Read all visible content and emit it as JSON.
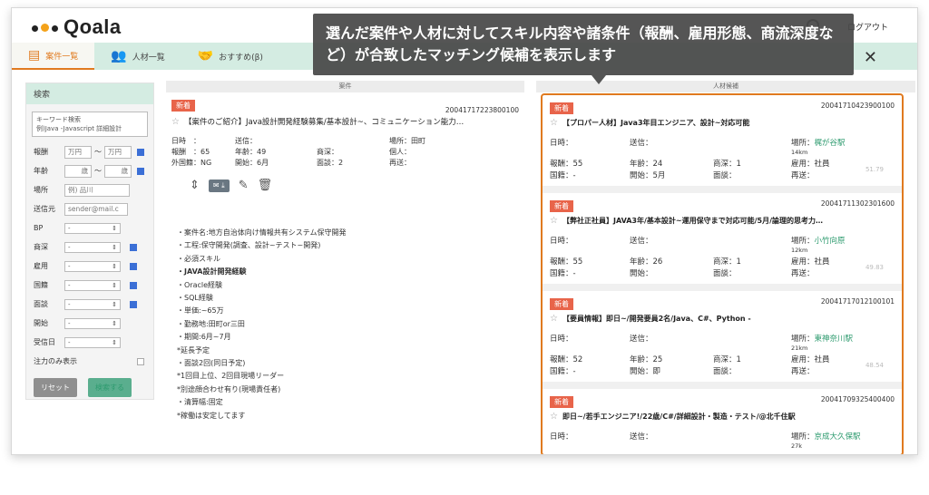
{
  "app": {
    "logo": "Qoala",
    "logout": "ログアウト"
  },
  "tabs": [
    {
      "label": "案件一覧",
      "icon": "list-icon"
    },
    {
      "label": "人材一覧",
      "icon": "people-icon"
    },
    {
      "label": "おすすめ(β)",
      "icon": "handshake-icon"
    }
  ],
  "callout": "選んだ案件や人材に対してスキル内容や諸条件（報酬、雇用形態、商流深度など）が合致したマッチング候補を表示します",
  "sidebar": {
    "title": "検索",
    "keyword_placeholder": "キーワード検索\n例)Java -Javascript 詳細設計",
    "reward_label": "報酬",
    "reward_from": "万円",
    "reward_sep": "〜",
    "reward_to": "万円",
    "age_label": "年齢",
    "age_from": "歳",
    "age_sep": "〜",
    "age_to": "歳",
    "place_label": "場所",
    "place_placeholder": "例) 品川",
    "sender_label": "送信元",
    "sender_placeholder": "sender@mail.c",
    "bp_label": "BP",
    "shoryu_label": "商深",
    "koyo_label": "雇用",
    "kokuseki_label": "国籍",
    "mensetsu_label": "面談",
    "kaishi_label": "開始",
    "jushin_label": "受信日",
    "select_value": "-",
    "focus_label": "注力のみ表示",
    "reset": "リセット",
    "search": "検索する"
  },
  "middle": {
    "header": "案件",
    "badge": "新着",
    "id": "20041717223800100",
    "title": "【案件のご紹介】Java設計開発経験募集/基本設計~、コミュニケーション能力…",
    "fields": [
      [
        "日時　：",
        "送信：",
        "",
        "場所：田町"
      ],
      [
        "報酬　：65",
        "年齢：49",
        "商深：",
        "個人："
      ],
      [
        "外国籍：NG",
        "開始：6月",
        "面談：2",
        "再送："
      ]
    ],
    "desc": [
      "・案件名:地方自治体向け情報共有システム保守開発",
      "・工程:保守開発(調査、設計~テスト~開発)",
      "・必須スキル",
      "・JAVA設計開発経験",
      "・Oracle経験",
      "・SQL経験",
      "・単価:~65万",
      "・勤務地:田町or三田",
      "・期間:6月~7月",
      "*延長予定",
      "・面談2回(同日予定)",
      "*1回目上位、2回目現場リーダー",
      "*別途顔合わせ有り(現場責任者)",
      "・清算幅:固定",
      "*稼働は安定してます"
    ]
  },
  "right": {
    "header": "人材候補",
    "cards": [
      {
        "badge": "新着",
        "id": "20041710423900100",
        "title": "【プロパー人材】Java3年目エンジニア、設計~対応可能",
        "c1": [
          "日時：",
          "報酬：55",
          "国籍：-"
        ],
        "c2": [
          "送信：",
          "年齢：24",
          "開始：5月"
        ],
        "c3": [
          "",
          "商深：1",
          "面談："
        ],
        "place": "場所：",
        "station": "梶が谷駅",
        "km": "14km",
        "koyo": "雇用：社員",
        "saiso": "再送：",
        "score": "51.79"
      },
      {
        "badge": "新着",
        "id": "20041711302301600",
        "title": "【弊社正社員】JAVA3年/基本設計~運用保守まで対応可能/5月/論理的思考力…",
        "c1": [
          "日時：",
          "報酬：55",
          "国籍：-"
        ],
        "c2": [
          "送信：",
          "年齢：26",
          "開始："
        ],
        "c3": [
          "",
          "商深：1",
          "面談："
        ],
        "place": "場所：",
        "station": "小竹向原",
        "km": "12km",
        "koyo": "雇用：社員",
        "saiso": "再送：",
        "score": "49.83"
      },
      {
        "badge": "新着",
        "id": "20041717012100101",
        "title": "【要員情報】即日~/開発要員2名/Java、C#、Python -",
        "c1": [
          "日時：",
          "報酬：52",
          "国籍：-"
        ],
        "c2": [
          "送信：",
          "年齢：25",
          "開始：即"
        ],
        "c3": [
          "",
          "商深：1",
          "面談："
        ],
        "place": "場所：",
        "station": "東神奈川駅",
        "km": "21km",
        "koyo": "雇用：社員",
        "saiso": "再送：",
        "score": "48.54"
      },
      {
        "badge": "新着",
        "id": "20041709325400400",
        "title": "即日~/若手エンジニア!/22歳/C#/詳細設計・製造・テスト/@北千住駅",
        "c1": [
          "日時：",
          "",
          ""
        ],
        "c2": [
          "送信：",
          "",
          ""
        ],
        "c3": [
          "",
          "",
          ""
        ],
        "place": "場所：",
        "station": "京成大久保駅",
        "km": "27k",
        "koyo": "",
        "saiso": "",
        "score": ""
      }
    ]
  },
  "colors": {
    "accent": "#e07a1f",
    "tabbar": "#d4ece2",
    "badge": "#e8644a",
    "station": "#2e9b6f"
  }
}
